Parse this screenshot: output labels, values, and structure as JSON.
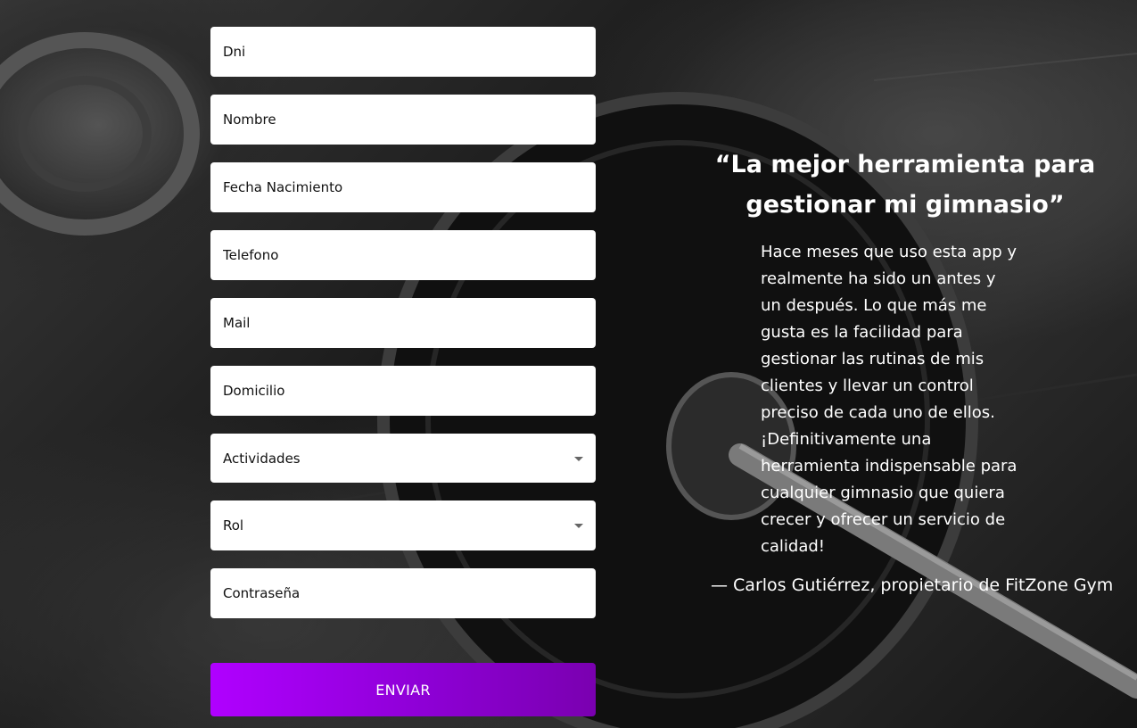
{
  "form": {
    "fields": [
      {
        "placeholder": "Dni"
      },
      {
        "placeholder": "Nombre"
      },
      {
        "placeholder": "Fecha Nacimiento"
      },
      {
        "placeholder": "Telefono"
      },
      {
        "placeholder": "Mail"
      },
      {
        "placeholder": "Domicilio"
      }
    ],
    "selects": [
      {
        "value": "Actividades"
      },
      {
        "value": "Rol"
      }
    ],
    "password": {
      "placeholder": "Contraseña"
    },
    "submit_label": "ENVIAR"
  },
  "testimonial": {
    "title": "“La mejor herramienta para gestionar mi gimnasio”",
    "body": "Hace meses que uso esta app y realmente ha sido un antes y un después. Lo que más me gusta es la facilidad para gestionar las rutinas de mis clientes y llevar un control preciso de cada uno de ellos. ¡Definitivamente una herramienta indispensable para cualquier gimnasio que quiera crecer y ofrecer un servicio de calidad!",
    "author": "— Carlos Gutiérrez, propietario de FitZone Gym"
  },
  "colors": {
    "button_gradient_start": "#b000ff",
    "button_gradient_end": "#7a00b0",
    "field_background": "#ffffff",
    "text_light": "#ffffff"
  }
}
